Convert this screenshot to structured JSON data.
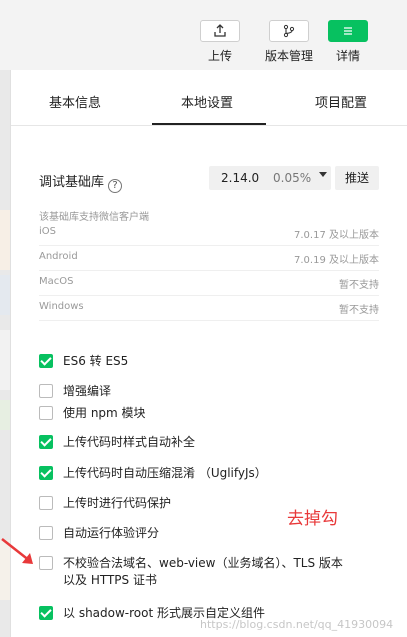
{
  "toolbar": {
    "upload_label": "上传",
    "version_label": "版本管理",
    "detail_label": "详情"
  },
  "tabs": [
    {
      "label": "基本信息"
    },
    {
      "label": "本地设置"
    },
    {
      "label": "项目配置"
    }
  ],
  "lib": {
    "label": "调试基础库",
    "help": "?",
    "version": "2.14.0",
    "percent": "0.05%",
    "push_label": "推送"
  },
  "support": {
    "title": "该基础库支持微信客户端",
    "rows": [
      {
        "os": "iOS",
        "req": "7.0.17 及以上版本"
      },
      {
        "os": "Android",
        "req": "7.0.19 及以上版本"
      },
      {
        "os": "MacOS",
        "req": "暂不支持"
      },
      {
        "os": "Windows",
        "req": "暂不支持"
      }
    ]
  },
  "options": [
    {
      "label": "ES6 转 ES5",
      "checked": true
    },
    {
      "label": "增强编译",
      "checked": false
    },
    {
      "label": "使用 npm 模块",
      "checked": false
    },
    {
      "label": "上传代码时样式自动补全",
      "checked": true
    },
    {
      "label": "上传代码时自动压缩混淆 （UglifyJs）",
      "checked": true
    },
    {
      "label": "上传时进行代码保护",
      "checked": false
    },
    {
      "label": "自动运行体验评分",
      "checked": false
    },
    {
      "label": "不校验合法域名、web-view（业务域名）、TLS 版本以及 HTTPS 证书",
      "checked": false
    },
    {
      "label": "以 shadow-root 形式展示自定义组件",
      "checked": true
    }
  ],
  "annotation": {
    "text": "去掉勾",
    "color": "#e8393a"
  },
  "watermark": "https://blog.csdn.net/qq_41930094",
  "colors": {
    "accent": "#07c160"
  }
}
